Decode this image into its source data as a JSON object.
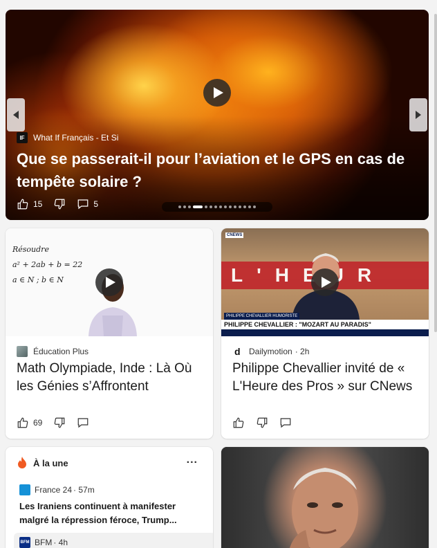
{
  "hero": {
    "source_logo": "IF",
    "source": "What If Français - Et Si",
    "title": "Que se passerait-il pour l’aviation et le GPS en cas de tempête solaire ?",
    "likes": "15",
    "comments": "5",
    "carousel_total": 15,
    "carousel_active": 3
  },
  "card_math": {
    "source": "Éducation Plus",
    "title": "Math Olympiade, Inde : Là Où les Génies s’Affrontent",
    "likes": "69",
    "whiteboard": [
      "Résoudre",
      "a² + 2ab + b = 22",
      "a ∈ N ; b ∈ N"
    ]
  },
  "card_news": {
    "source": "Dailymotion",
    "time": "· 2h",
    "title": "Philippe Chevallier invité de « L'Heure des Pros » sur CNews",
    "thumb_sign": "L'HEUR",
    "thumb_tag": "PHILIPPE CHEVALLIER HUMORISTE",
    "thumb_bar": "PHILIPPE CHEVALLIER : \"MOZART AU PARADIS\"",
    "thumb_logo": "CNEWS"
  },
  "une": {
    "label": "À la une",
    "more": "...",
    "items": [
      {
        "source": "France 24",
        "time": "· 57m",
        "title": "Les Iraniens continuent à manifester malgré la répression féroce, Trump..."
      },
      {
        "source": "BFM",
        "time": "· 4h",
        "logo": "BFM"
      }
    ]
  },
  "colors": {
    "accent_orange": "#f05a22",
    "france24": "#1591d7",
    "bfm": "#0b2f86"
  }
}
